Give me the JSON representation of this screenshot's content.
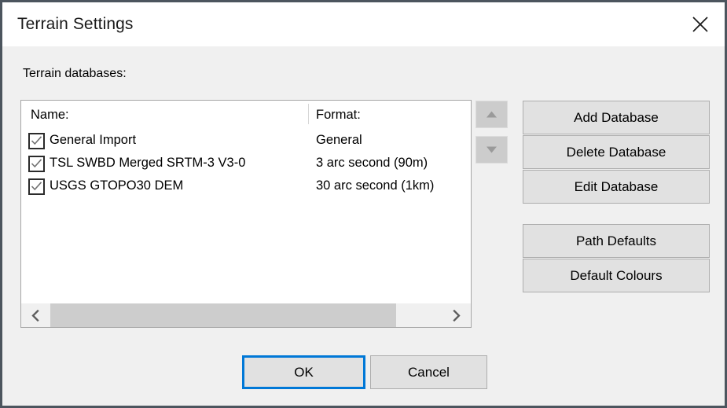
{
  "window": {
    "title": "Terrain Settings",
    "close_icon": "close-icon",
    "border_color": "#4c555e",
    "titlebar_bg": "#ffffff",
    "body_bg": "#f0f0f0"
  },
  "main": {
    "list_label": "Terrain databases:",
    "columns": [
      "Name:",
      "Format:"
    ],
    "rows": [
      {
        "checked": true,
        "name": "General Import",
        "format": "General"
      },
      {
        "checked": true,
        "name": "TSL SWBD Merged SRTM-3 V3-0",
        "format": "3 arc second (90m)"
      },
      {
        "checked": true,
        "name": "USGS GTOPO30 DEM",
        "format": "30 arc second (1km)"
      }
    ],
    "scrollbar": {
      "left_arrow_icon": "chevron-left-icon",
      "right_arrow_icon": "chevron-right-icon",
      "thumb_color": "#cdcdcd",
      "track_color": "#f0f0f0"
    },
    "move_up": {
      "icon": "triangle-up-icon",
      "enabled": false
    },
    "move_down": {
      "icon": "triangle-down-icon",
      "enabled": false
    }
  },
  "buttons": {
    "add_database": "Add Database",
    "delete_database": "Delete Database",
    "edit_database": "Edit Database",
    "path_defaults": "Path Defaults",
    "default_colours": "Default Colours",
    "ok": "OK",
    "cancel": "Cancel",
    "ok_focus_color": "#0078d7",
    "face_color": "#e1e1e1",
    "border_color": "#adadad"
  }
}
